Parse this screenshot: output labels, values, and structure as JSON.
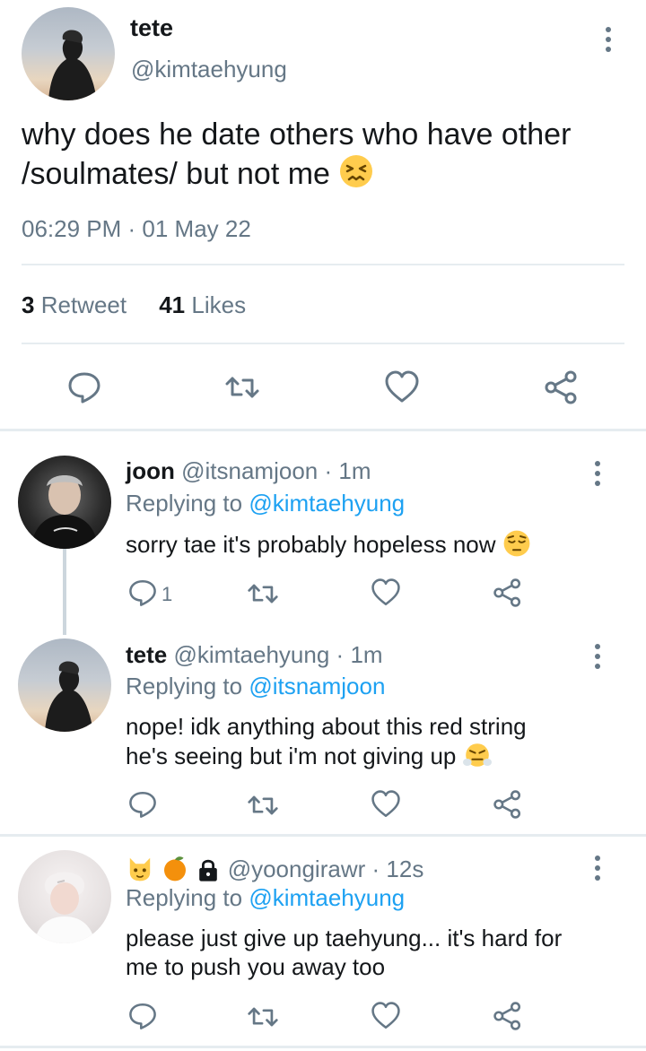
{
  "main_tweet": {
    "name": "tete",
    "handle": "@kimtaehyung",
    "text": "why does he date others who have other /soulmates/ but not me",
    "emoji": "confounded-face-emoji",
    "timestamp": "06:29 PM · 01 May 22",
    "retweet_count": "3",
    "retweet_label": "Retweet",
    "likes_count": "41",
    "likes_label": "Likes",
    "actions": [
      "reply-icon",
      "retweet-icon",
      "like-icon",
      "share-icon"
    ]
  },
  "replies": [
    {
      "name": "joon",
      "handle": "@itsnamjoon",
      "time": "1m",
      "replying_label": "Replying to",
      "replying_to": "@kimtaehyung",
      "text": "sorry tae it's probably hopeless now",
      "emoji": "pensive-face-emoji",
      "reply_count": "1"
    },
    {
      "name": "tete",
      "handle": "@kimtaehyung",
      "time": "1m",
      "replying_label": "Replying to",
      "replying_to": "@itsnamjoon",
      "text_line1": "nope! idk anything about this red string",
      "text_line2": "he's seeing but i'm not giving up",
      "emoji": "face-with-steam-emoji"
    },
    {
      "name_emojis": [
        "cat-face-emoji",
        "tangerine-emoji",
        "lock-icon"
      ],
      "handle": "@yoongirawr",
      "time": "12s",
      "replying_label": "Replying to",
      "replying_to": "@kimtaehyung",
      "text_line1": "please just give up taehyung... it's hard for",
      "text_line2": "me to push you away too"
    }
  ],
  "colors": {
    "text": "#14171a",
    "secondary": "#657786",
    "link": "#1da1f2",
    "divider": "#e6ecf0"
  }
}
